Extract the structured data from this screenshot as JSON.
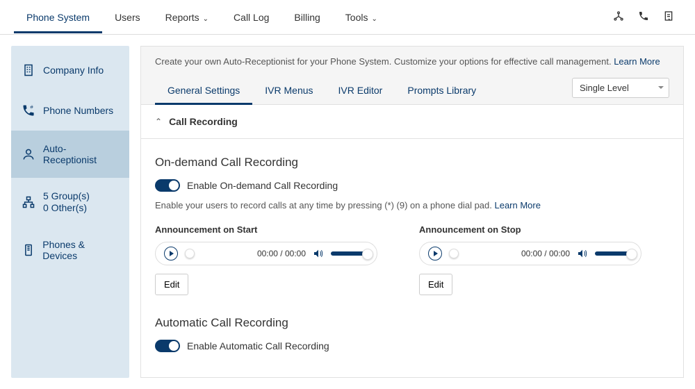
{
  "topnav": {
    "items": [
      "Phone System",
      "Users",
      "Reports",
      "Call Log",
      "Billing",
      "Tools"
    ]
  },
  "sidebar": {
    "items": [
      {
        "label": "Company Info"
      },
      {
        "label": "Phone Numbers"
      },
      {
        "label": "Auto-Receptionist"
      },
      {
        "line1": "5 Group(s)",
        "line2": "0 Other(s)"
      },
      {
        "label": "Phones & Devices"
      }
    ]
  },
  "banner": {
    "desc": "Create your own Auto-Receptionist for your Phone System. Customize your options for effective call management. ",
    "learnMore": "Learn More"
  },
  "tabs": [
    "General Settings",
    "IVR Menus",
    "IVR Editor",
    "Prompts Library"
  ],
  "levelSelect": "Single Level",
  "section": {
    "title": "Call Recording"
  },
  "onDemand": {
    "title": "On-demand Call Recording",
    "toggleLabel": "Enable On-demand Call Recording",
    "hint": "Enable your users to record calls at any time by pressing (*) (9) on a phone dial pad. ",
    "learnMore": "Learn More",
    "annStart": {
      "label": "Announcement on Start",
      "time": "00:00 / 00:00",
      "edit": "Edit"
    },
    "annStop": {
      "label": "Announcement on Stop",
      "time": "00:00 / 00:00",
      "edit": "Edit"
    }
  },
  "automatic": {
    "title": "Automatic Call Recording",
    "toggleLabel": "Enable Automatic Call Recording"
  }
}
